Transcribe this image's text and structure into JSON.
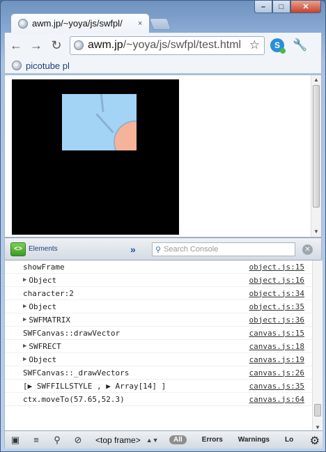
{
  "window": {
    "minimize": "–",
    "maximize": "□",
    "close": "✕"
  },
  "tab": {
    "title": "awm.jp/~yoya/js/swfpl/",
    "close": "×"
  },
  "toolbar": {
    "url_host": "awm.jp",
    "url_path": "/~yoya/js/swfpl/test.html",
    "ext_label": "S"
  },
  "bookmarks": [
    {
      "label": "picotube pl"
    }
  ],
  "devtools": {
    "elements_label": "Elements",
    "search_placeholder": "Search Console",
    "console_rows": [
      {
        "text": "showFrame",
        "expandable": false,
        "source": "object.js:15"
      },
      {
        "text": "Object",
        "expandable": true,
        "source": "object.js:16"
      },
      {
        "text": "character:2",
        "expandable": false,
        "source": "object.js:34"
      },
      {
        "text": "Object",
        "expandable": true,
        "source": "object.js:35"
      },
      {
        "text": "SWFMATRIX",
        "expandable": true,
        "source": "object.js:36"
      },
      {
        "text": "SWFCanvas::drawVector",
        "expandable": false,
        "source": "canvas.js:15"
      },
      {
        "text": "SWFRECT",
        "expandable": true,
        "source": "canvas.js:18"
      },
      {
        "text": "Object",
        "expandable": true,
        "source": "canvas.js:19"
      },
      {
        "text": "SWFCanvas::_drawVectors",
        "expandable": false,
        "source": "canvas.js:26"
      },
      {
        "text": "[▶ SWFFILLSTYLE , ▶ Array[14] ]",
        "expandable": false,
        "source": "canvas.js:35"
      },
      {
        "text": "ctx.moveTo(57.65,52.3)",
        "expandable": false,
        "source": "canvas.js:64"
      }
    ],
    "prompt": "›",
    "frame_select": "<top frame>",
    "filters": {
      "all": "All",
      "errors": "Errors",
      "warnings": "Warnings",
      "logs": "Lo"
    }
  },
  "colors": {
    "stage": "#000000",
    "sprite_sky": "#a4d4f5",
    "sprite_circle": "#f5b49a"
  }
}
